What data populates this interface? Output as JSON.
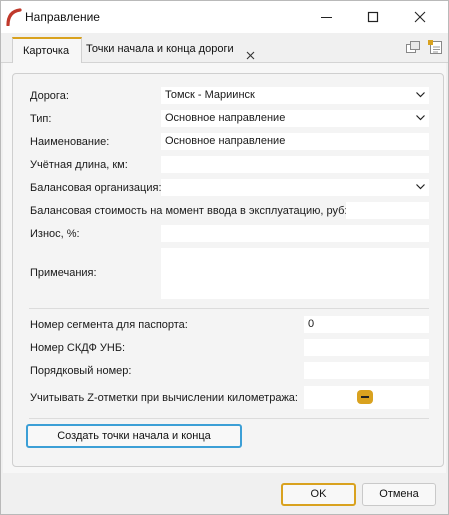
{
  "window": {
    "title": "Направление"
  },
  "tabs": [
    {
      "label": "Карточка",
      "active": true
    },
    {
      "label": "Точки начала и конца дороги",
      "active": false
    }
  ],
  "form": {
    "road": {
      "label": "Дорога:",
      "value": "Томск - Мариинск"
    },
    "type": {
      "label": "Тип:",
      "value": "Основное направление"
    },
    "name": {
      "label": "Наименование:",
      "value": "Основное направление"
    },
    "length": {
      "label": "Учётная длина, км:",
      "value": ""
    },
    "org": {
      "label": "Балансовая организация:",
      "value": ""
    },
    "cost": {
      "label": "Балансовая стоимость на момент ввода в эксплуатацию, руб:",
      "value": ""
    },
    "wear": {
      "label": "Износ, %:",
      "value": ""
    },
    "notes": {
      "label": "Примечания:",
      "value": ""
    },
    "segment": {
      "label": "Номер сегмента для паспорта:",
      "value": "0"
    },
    "skdf": {
      "label": "Номер СКДФ УНБ:",
      "value": ""
    },
    "order": {
      "label": "Порядковый номер:",
      "value": ""
    },
    "zmarks": {
      "label": "Учитывать Z-отметки при вычислении километража:",
      "state": "indeterminate"
    }
  },
  "buttons": {
    "create": "Создать точки начала и конца",
    "ok": "OK",
    "cancel": "Отмена"
  },
  "colors": {
    "accent": "#d9a21f",
    "focus": "#3c9fd6",
    "app_icon": "#c0392b"
  }
}
